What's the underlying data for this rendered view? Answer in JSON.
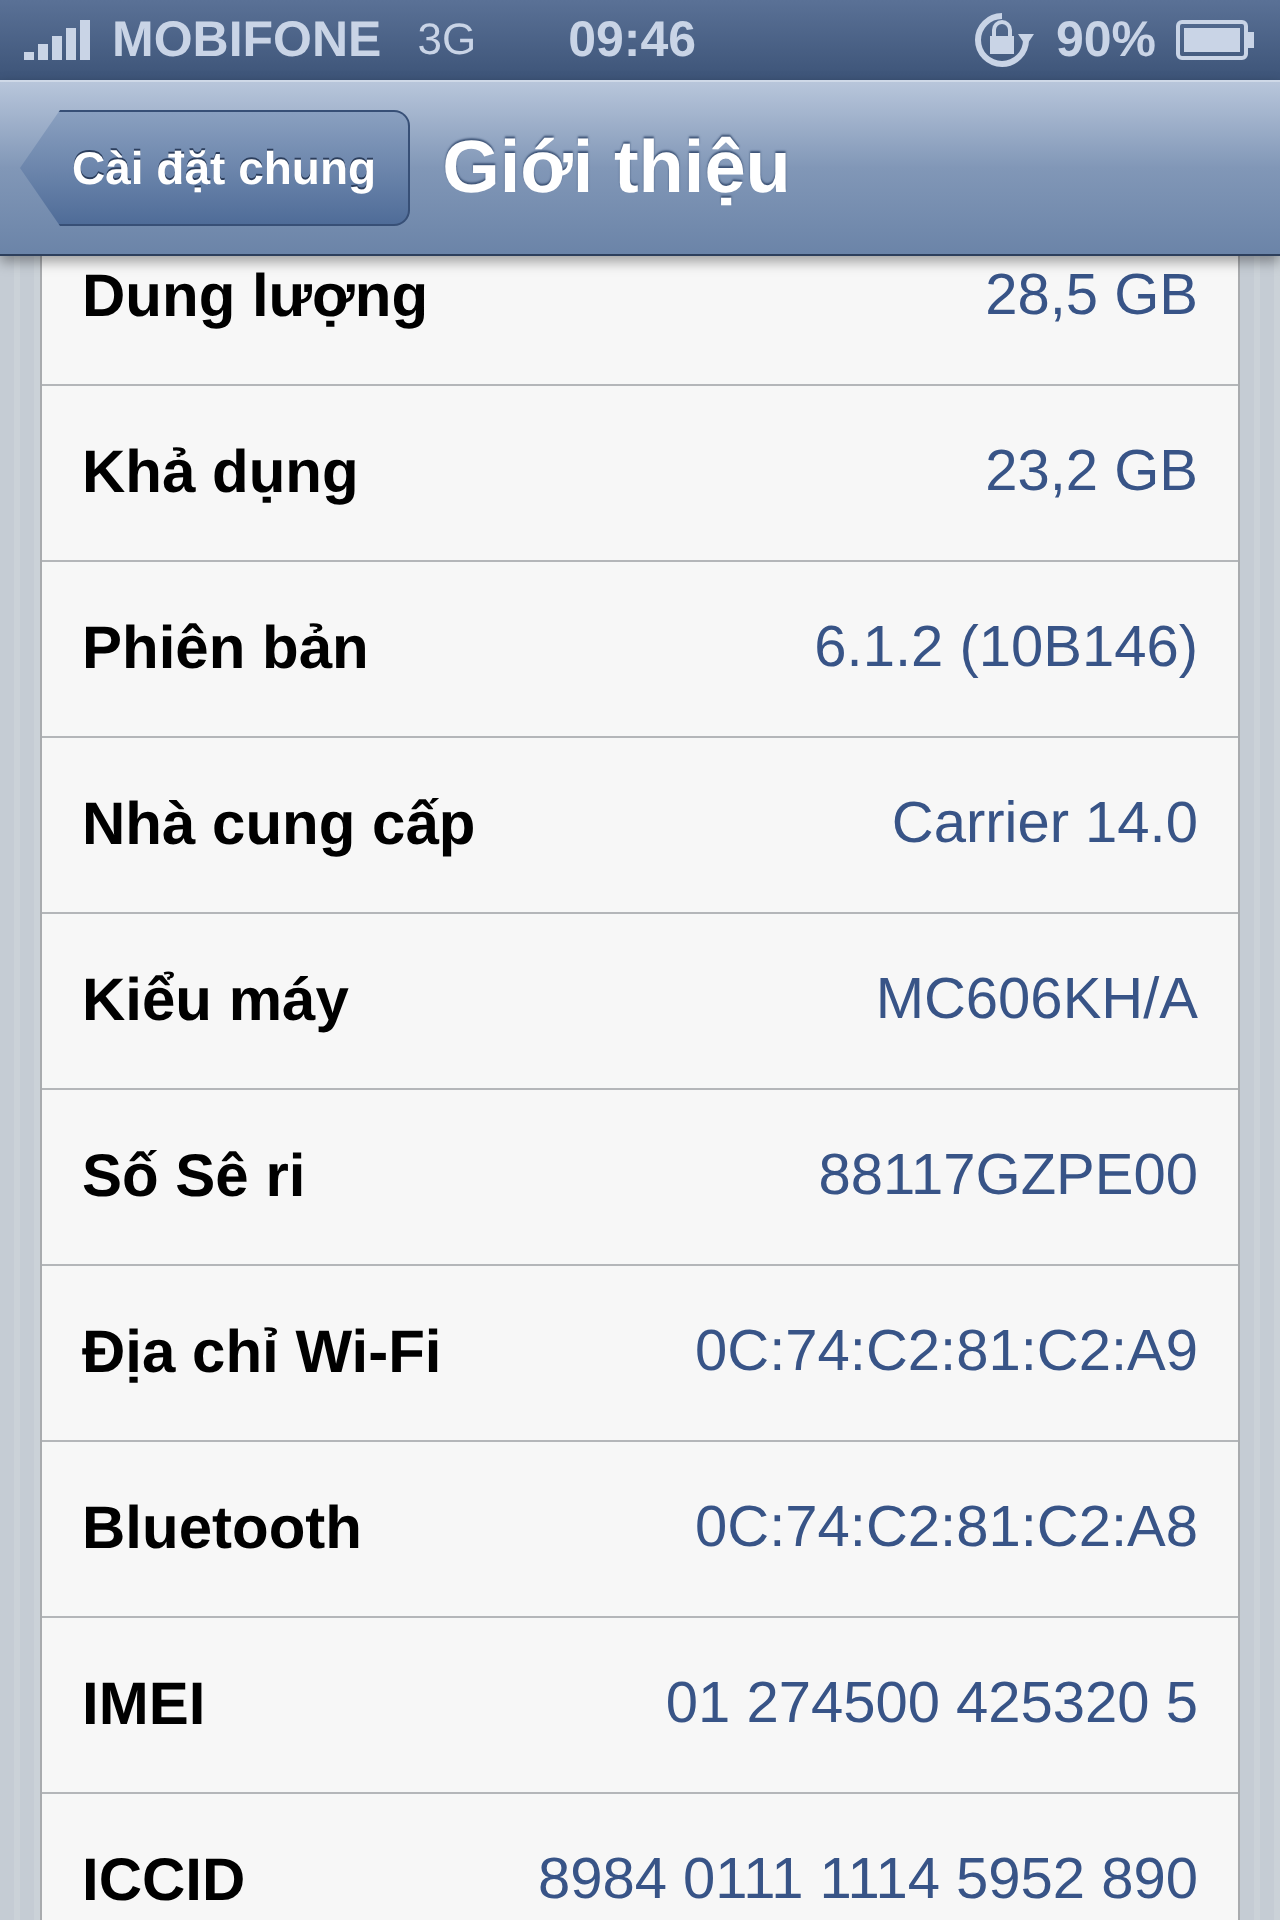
{
  "status_bar": {
    "carrier": "MOBIFONE",
    "network": "3G",
    "time": "09:46",
    "battery": "90%"
  },
  "nav_bar": {
    "back": "Cài đặt chung",
    "title": "Giới thiệu"
  },
  "rows": [
    {
      "label": "Dung lượng",
      "value": "28,5 GB"
    },
    {
      "label": "Khả dụng",
      "value": "23,2 GB"
    },
    {
      "label": "Phiên bản",
      "value": "6.1.2 (10B146)"
    },
    {
      "label": "Nhà cung cấp",
      "value": "Carrier 14.0"
    },
    {
      "label": "Kiểu máy",
      "value": "MC606KH/A"
    },
    {
      "label": "Số Sê ri",
      "value": "88117GZPE00"
    },
    {
      "label": "Địa chỉ Wi-Fi",
      "value": "0C:74:C2:81:C2:A9"
    },
    {
      "label": "Bluetooth",
      "value": "0C:74:C2:81:C2:A8"
    },
    {
      "label": "IMEI",
      "value": "01 274500 425320 5"
    },
    {
      "label": "ICCID",
      "value": "8984 0111 1114 5952 890"
    }
  ]
}
